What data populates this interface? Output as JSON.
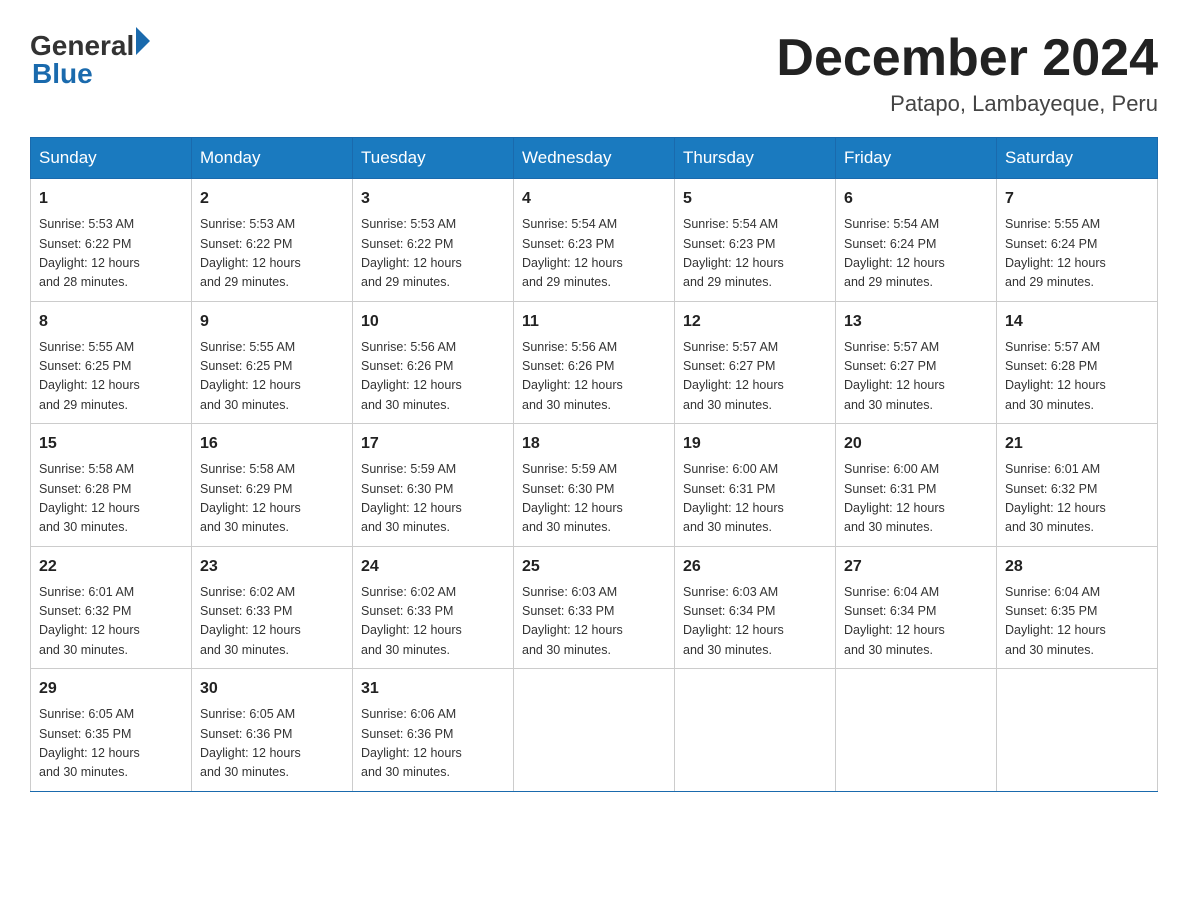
{
  "header": {
    "logo_general": "General",
    "logo_blue": "Blue",
    "month_year": "December 2024",
    "location": "Patapo, Lambayeque, Peru"
  },
  "days_of_week": [
    "Sunday",
    "Monday",
    "Tuesday",
    "Wednesday",
    "Thursday",
    "Friday",
    "Saturday"
  ],
  "weeks": [
    [
      {
        "day": 1,
        "sunrise": "5:53 AM",
        "sunset": "6:22 PM",
        "daylight": "12 hours and 28 minutes."
      },
      {
        "day": 2,
        "sunrise": "5:53 AM",
        "sunset": "6:22 PM",
        "daylight": "12 hours and 29 minutes."
      },
      {
        "day": 3,
        "sunrise": "5:53 AM",
        "sunset": "6:22 PM",
        "daylight": "12 hours and 29 minutes."
      },
      {
        "day": 4,
        "sunrise": "5:54 AM",
        "sunset": "6:23 PM",
        "daylight": "12 hours and 29 minutes."
      },
      {
        "day": 5,
        "sunrise": "5:54 AM",
        "sunset": "6:23 PM",
        "daylight": "12 hours and 29 minutes."
      },
      {
        "day": 6,
        "sunrise": "5:54 AM",
        "sunset": "6:24 PM",
        "daylight": "12 hours and 29 minutes."
      },
      {
        "day": 7,
        "sunrise": "5:55 AM",
        "sunset": "6:24 PM",
        "daylight": "12 hours and 29 minutes."
      }
    ],
    [
      {
        "day": 8,
        "sunrise": "5:55 AM",
        "sunset": "6:25 PM",
        "daylight": "12 hours and 29 minutes."
      },
      {
        "day": 9,
        "sunrise": "5:55 AM",
        "sunset": "6:25 PM",
        "daylight": "12 hours and 30 minutes."
      },
      {
        "day": 10,
        "sunrise": "5:56 AM",
        "sunset": "6:26 PM",
        "daylight": "12 hours and 30 minutes."
      },
      {
        "day": 11,
        "sunrise": "5:56 AM",
        "sunset": "6:26 PM",
        "daylight": "12 hours and 30 minutes."
      },
      {
        "day": 12,
        "sunrise": "5:57 AM",
        "sunset": "6:27 PM",
        "daylight": "12 hours and 30 minutes."
      },
      {
        "day": 13,
        "sunrise": "5:57 AM",
        "sunset": "6:27 PM",
        "daylight": "12 hours and 30 minutes."
      },
      {
        "day": 14,
        "sunrise": "5:57 AM",
        "sunset": "6:28 PM",
        "daylight": "12 hours and 30 minutes."
      }
    ],
    [
      {
        "day": 15,
        "sunrise": "5:58 AM",
        "sunset": "6:28 PM",
        "daylight": "12 hours and 30 minutes."
      },
      {
        "day": 16,
        "sunrise": "5:58 AM",
        "sunset": "6:29 PM",
        "daylight": "12 hours and 30 minutes."
      },
      {
        "day": 17,
        "sunrise": "5:59 AM",
        "sunset": "6:30 PM",
        "daylight": "12 hours and 30 minutes."
      },
      {
        "day": 18,
        "sunrise": "5:59 AM",
        "sunset": "6:30 PM",
        "daylight": "12 hours and 30 minutes."
      },
      {
        "day": 19,
        "sunrise": "6:00 AM",
        "sunset": "6:31 PM",
        "daylight": "12 hours and 30 minutes."
      },
      {
        "day": 20,
        "sunrise": "6:00 AM",
        "sunset": "6:31 PM",
        "daylight": "12 hours and 30 minutes."
      },
      {
        "day": 21,
        "sunrise": "6:01 AM",
        "sunset": "6:32 PM",
        "daylight": "12 hours and 30 minutes."
      }
    ],
    [
      {
        "day": 22,
        "sunrise": "6:01 AM",
        "sunset": "6:32 PM",
        "daylight": "12 hours and 30 minutes."
      },
      {
        "day": 23,
        "sunrise": "6:02 AM",
        "sunset": "6:33 PM",
        "daylight": "12 hours and 30 minutes."
      },
      {
        "day": 24,
        "sunrise": "6:02 AM",
        "sunset": "6:33 PM",
        "daylight": "12 hours and 30 minutes."
      },
      {
        "day": 25,
        "sunrise": "6:03 AM",
        "sunset": "6:33 PM",
        "daylight": "12 hours and 30 minutes."
      },
      {
        "day": 26,
        "sunrise": "6:03 AM",
        "sunset": "6:34 PM",
        "daylight": "12 hours and 30 minutes."
      },
      {
        "day": 27,
        "sunrise": "6:04 AM",
        "sunset": "6:34 PM",
        "daylight": "12 hours and 30 minutes."
      },
      {
        "day": 28,
        "sunrise": "6:04 AM",
        "sunset": "6:35 PM",
        "daylight": "12 hours and 30 minutes."
      }
    ],
    [
      {
        "day": 29,
        "sunrise": "6:05 AM",
        "sunset": "6:35 PM",
        "daylight": "12 hours and 30 minutes."
      },
      {
        "day": 30,
        "sunrise": "6:05 AM",
        "sunset": "6:36 PM",
        "daylight": "12 hours and 30 minutes."
      },
      {
        "day": 31,
        "sunrise": "6:06 AM",
        "sunset": "6:36 PM",
        "daylight": "12 hours and 30 minutes."
      },
      null,
      null,
      null,
      null
    ]
  ],
  "labels": {
    "sunrise": "Sunrise:",
    "sunset": "Sunset:",
    "daylight": "Daylight:"
  }
}
